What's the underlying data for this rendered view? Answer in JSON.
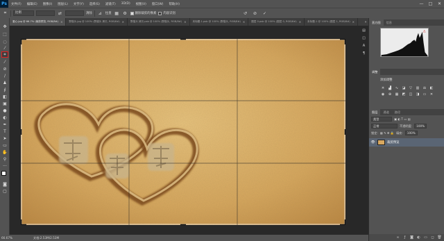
{
  "app": {
    "logo": "Ps"
  },
  "menu": [
    "文件(F)",
    "编辑(E)",
    "图像(I)",
    "图层(L)",
    "文字(Y)",
    "选择(S)",
    "滤镜(T)",
    "3D(D)",
    "视图(V)",
    "窗口(W)",
    "帮助(H)"
  ],
  "window_controls": [
    "—",
    "□",
    "✕"
  ],
  "options": {
    "ratio": "比例",
    "clear_label": "清除",
    "straighten_label": "拉直",
    "delete_cropped": "删除裁剪的像素",
    "content_aware": "内容识别",
    "delete_cropped_checked": true,
    "content_aware_checked": false
  },
  "tabs": [
    {
      "label": "爱心.jpg @ 66.7% (裁剪预览, RGB/8#)",
      "active": true
    },
    {
      "label": "野猫头.jpg @ 100% (野猫头 拷贝, RGB/8#)",
      "active": false
    },
    {
      "label": "野猫头 拷贝.psb @ 100% (野猫头, RGB/8#)",
      "active": false
    },
    {
      "label": "未标题-1.psb @ 100% (野猫头, RGB/8#)",
      "active": false
    },
    {
      "label": "图层 0.psb @ 100% (图层 0, RGB/8#)",
      "active": false
    },
    {
      "label": "未标题-1 @ 100% (图层 1, RGB/8#)",
      "active": false
    }
  ],
  "status": {
    "zoom": "66.67%",
    "doc": "文档:2.53M/2.53M"
  },
  "panels": {
    "hist_tabs": [
      "直方图",
      "信息"
    ],
    "adj_tabs": [
      "调整"
    ],
    "adj_title": "添加调整",
    "layers_tabs": [
      "图层",
      "通道",
      "路径"
    ],
    "kind": "类型",
    "blend": "正常",
    "opacity_label": "不透明度:",
    "opacity": "100%",
    "lock_label": "锁定:",
    "fill_label": "填充:",
    "fill": "100%",
    "layer_name": "裁剪预览"
  },
  "colors": {
    "accent_selected_tool": "#e02020",
    "sand": "#d9ae68"
  }
}
